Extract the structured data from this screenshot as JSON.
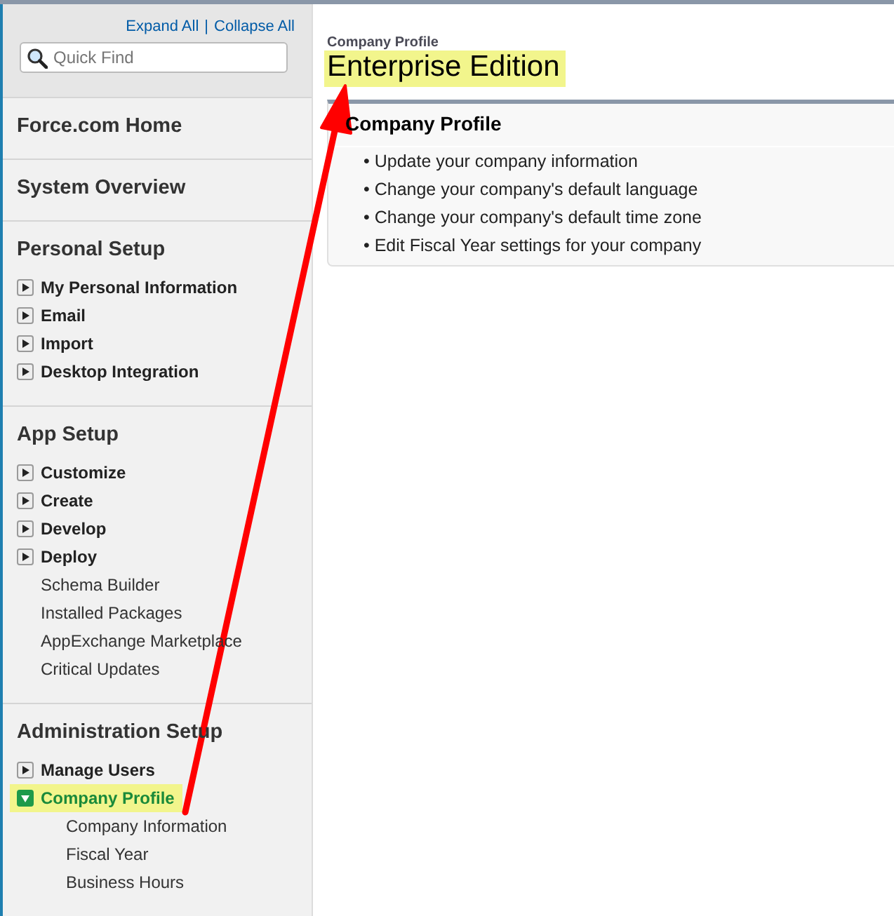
{
  "sidebar": {
    "links": [
      "Expand All",
      "Collapse All"
    ],
    "separator": "|",
    "search": {
      "placeholder": "Quick Find"
    },
    "sections": [
      {
        "title": "Force.com Home"
      },
      {
        "title": "System Overview"
      },
      {
        "title": "Personal Setup",
        "items": [
          {
            "kind": "toggle",
            "label": "My Personal Information",
            "expanded": false,
            "highlighted": false
          },
          {
            "kind": "toggle",
            "label": "Email",
            "expanded": false,
            "highlighted": false
          },
          {
            "kind": "toggle",
            "label": "Import",
            "expanded": false,
            "highlighted": false
          },
          {
            "kind": "toggle",
            "label": "Desktop Integration",
            "expanded": false,
            "highlighted": false
          }
        ]
      },
      {
        "title": "App Setup",
        "items": [
          {
            "kind": "toggle",
            "label": "Customize",
            "expanded": false,
            "highlighted": false
          },
          {
            "kind": "toggle",
            "label": "Create",
            "expanded": false,
            "highlighted": false
          },
          {
            "kind": "toggle",
            "label": "Develop",
            "expanded": false,
            "highlighted": false
          },
          {
            "kind": "toggle",
            "label": "Deploy",
            "expanded": false,
            "highlighted": false
          },
          {
            "kind": "link",
            "label": "Schema Builder"
          },
          {
            "kind": "link",
            "label": "Installed Packages"
          },
          {
            "kind": "link",
            "label": "AppExchange Marketplace"
          },
          {
            "kind": "link",
            "label": "Critical Updates"
          }
        ]
      },
      {
        "title": "Administration Setup",
        "items": [
          {
            "kind": "toggle",
            "label": "Manage Users",
            "expanded": false,
            "highlighted": false
          },
          {
            "kind": "toggle",
            "label": "Company Profile",
            "expanded": true,
            "highlighted": true,
            "children": [
              "Company Information",
              "Fiscal Year",
              "Business Hours"
            ]
          }
        ]
      }
    ]
  },
  "page": {
    "subtitle": "Company Profile",
    "title": "Enterprise Edition",
    "title_highlighted": true,
    "panel": {
      "title": "Company Profile",
      "items": [
        "• Update your company information",
        "• Change your company's default language",
        "• Change your company's default time zone",
        "• Edit Fiscal Year settings for your company"
      ]
    }
  }
}
